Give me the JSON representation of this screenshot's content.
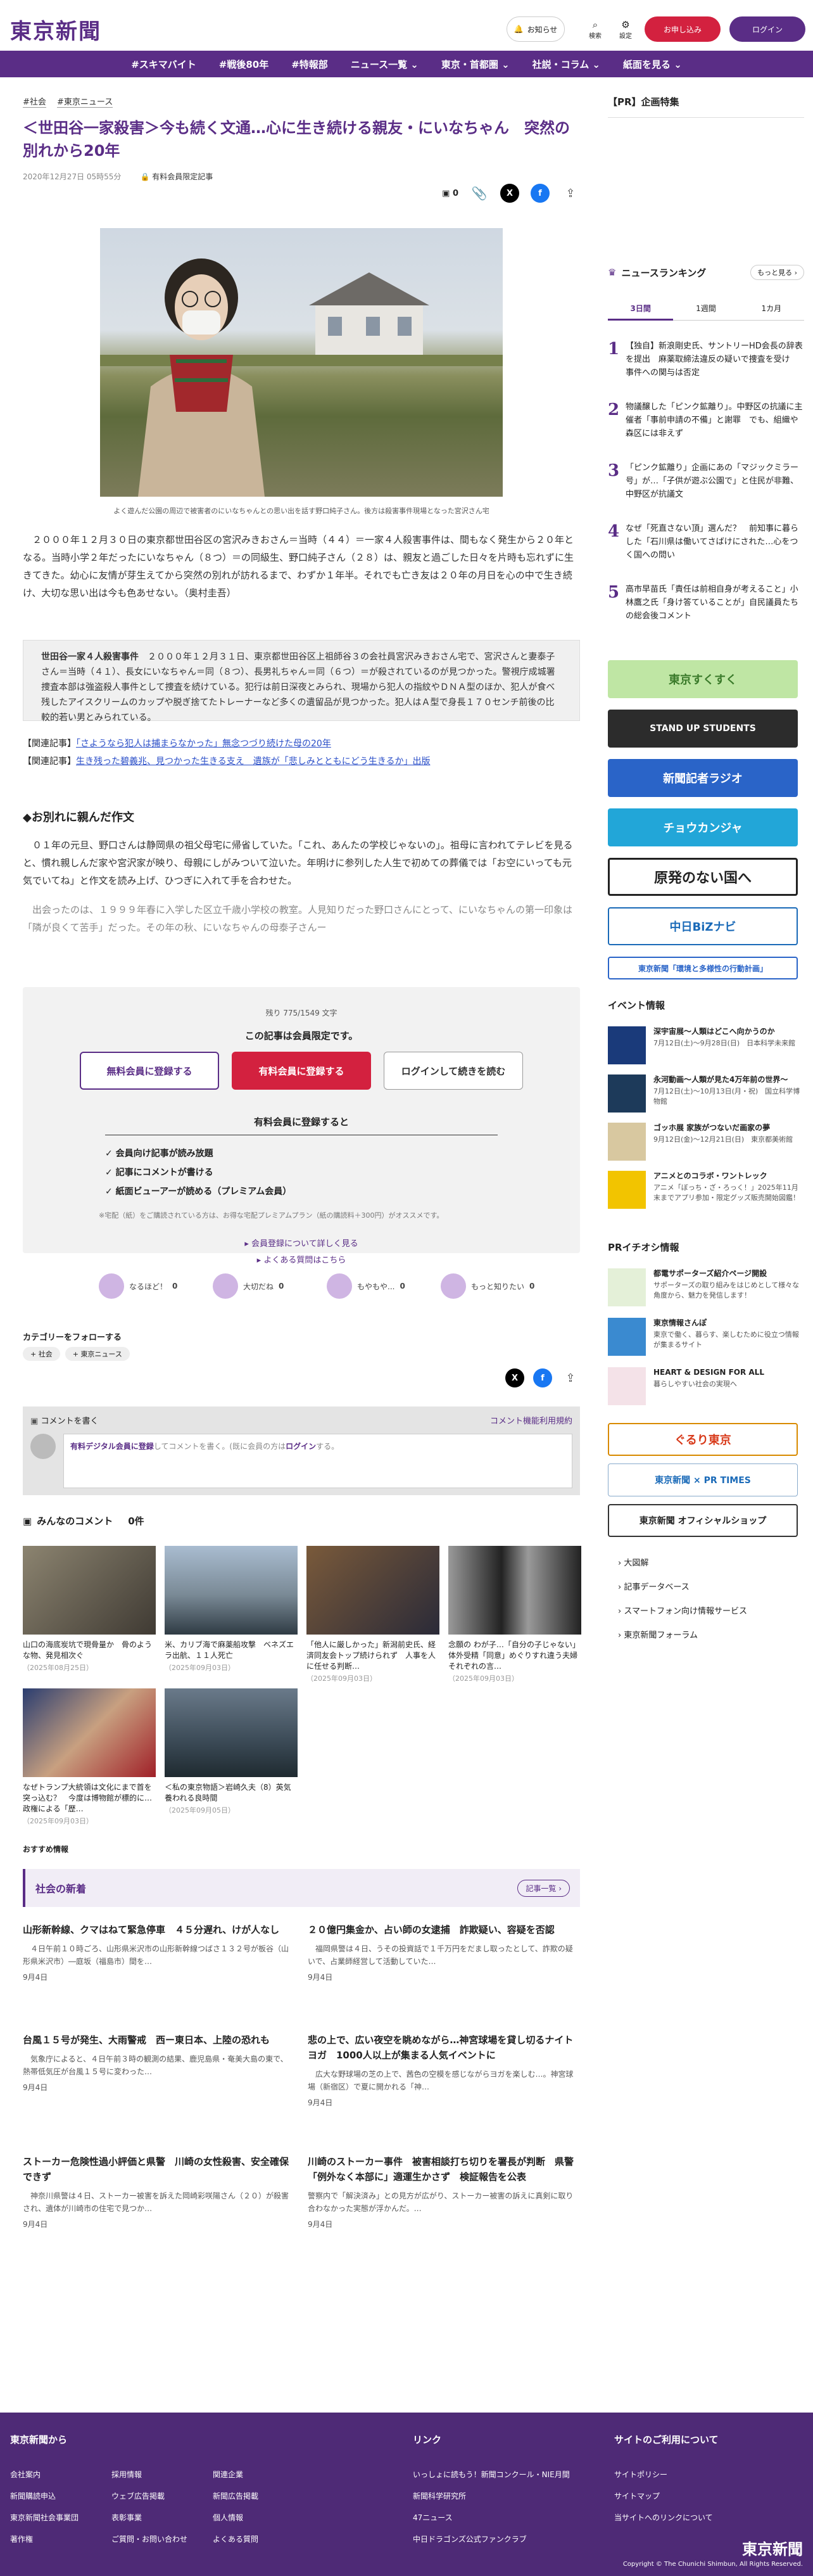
{
  "header": {
    "logo": "東京新聞",
    "notice": "お知らせ",
    "search": "検索",
    "settings": "設定",
    "subscribe": "お申し込み",
    "login": "ログイン"
  },
  "nav": [
    "#スキマバイト",
    "#戦後80年",
    "#特報部",
    "ニュース一覧 ⌄",
    "東京・首都圏 ⌄",
    "社説・コラム ⌄",
    "紙面を見る ⌄"
  ],
  "article": {
    "tags": [
      "#社会",
      "#東京ニュース"
    ],
    "title": "＜世田谷一家殺害＞今も続く文通…心に生き続ける親友・にいなちゃん　突然の別れから20年",
    "date": "2020年12月27日 05時55分",
    "member_label": "有料会員限定記事",
    "comment_count": "0",
    "caption": "よく遊んだ公園の周辺で被害者のにいなちゃんとの思い出を話す野口純子さん。後方は殺害事件現場となった宮沢さん宅",
    "lead": "　２０００年１２月３０日の東京都世田谷区の宮沢みきおさん＝当時（４４）＝一家４人殺害事件は、間もなく発生から２０年となる。当時小学２年だったにいなちゃん（８つ）＝の同級生、野口純子さん（２８）は、親友と過ごした日々を片時も忘れずに生きてきた。幼心に友情が芽生えてから突然の別れが訪れるまで、わずか１年半。それでも亡き友は２０年の月日を心の中で生き続け、大切な思い出は今も色あせない。（奥村圭吾）",
    "box_title": "世田谷一家４人殺害事件",
    "box_text": "　２０００年１２月３１日、東京都世田谷区上祖師谷３の会社員宮沢みきおさん宅で、宮沢さんと妻泰子さん＝当時（４１）、長女にいなちゃん＝同（８つ）、長男礼ちゃん＝同（６つ）＝が殺されているのが見つかった。警視庁成城署捜査本部は強盗殺人事件として捜査を続けている。犯行は前日深夜とみられ、現場から犯人の指紋やＤＮＡ型のほか、犯人が食べ残したアイスクリームのカップや脱ぎ捨てたトレーナーなど多くの遺留品が見つかった。犯人はＡ型で身長１７０センチ前後の比較的若い男とみられている。",
    "related_1_label": "【関連記事】",
    "related_1": "「さようなら犯人は捕まらなかった」無念つづり続けた母の20年",
    "related_2_label": "【関連記事】",
    "related_2": "生き残った碧義兆、見つかった生きる支え　遺族が「悲しみとともにどう生きるか」出版",
    "subhead": "◆お別れに親んだ作文",
    "para1": "　０１年の元旦、野口さんは静岡県の祖父母宅に帰省していた。「これ、あんたの学校じゃないの」。祖母に言われてテレビを見ると、慣れ親しんだ家や宮沢家が映り、母親にしがみついて泣いた。年明けに参列した人生で初めての葬儀では「お空にいっても元気でいてね」と作文を読み上げ、ひつぎに入れて手を合わせた。",
    "para2": "　出会ったのは、１９９９年春に入学した区立千歳小学校の教室。人見知りだった野口さんにとって、にいなちゃんの第一印象は「隣が良くて苦手」だった。その年の秋、にいなちゃんの母泰子さんー",
    "remaining": "残り 775/1549 文字",
    "paywall_title": "この記事は会員限定です。",
    "btn_free": "無料会員に登録する",
    "btn_paid": "有料会員に登録する",
    "btn_login": "ログインして続きを読む",
    "benefits_title": "有料会員に登録すると",
    "benefits": [
      "会員向け記事が読み放題",
      "記事にコメントが書ける",
      "紙面ビューアーが読める（プレミアム会員）"
    ],
    "note": "※宅配（紙）をご購読されている方は、お得な宅配プレミアムプラン（紙の購読料＋300円）がオススメです。",
    "more_1": "会員登録について詳しく見る",
    "more_2": "よくある質問はこちら",
    "reactions": [
      "なるほど！",
      "大切だね",
      "もやもや...",
      "もっと知りたい"
    ],
    "reaction_counts": [
      "0",
      "0",
      "0",
      "0"
    ],
    "follow": "カテゴリーをフォローする",
    "follow_tags": [
      "社会",
      "東京ニュース"
    ],
    "comment_write": "コメントを書く",
    "comment_terms": "コメント機能利用規約",
    "comment_placeholder_a": "有料デジタル会員に登録",
    "comment_placeholder_b": "してコメントを書く。(既に会員の方は",
    "comment_placeholder_c": "ログイン",
    "comment_placeholder_d": "する。",
    "all_comments": "みんなのコメント",
    "all_comments_count": "0件"
  },
  "cards": [
    {
      "title": "山口の海底炭坑で現骨量か　骨のような物、発見相次ぐ",
      "date": "（2025年08月25日）"
    },
    {
      "title": "米、カリブ海で麻薬船攻撃　ベネズエラ出航、１１人死亡",
      "date": "（2025年09月03日）"
    },
    {
      "title": "「他人に厳しかった」新潟前史氏、経済同友会トップ続けられず　人事を人に任せる判断…",
      "date": "（2025年09月03日）"
    },
    {
      "title": "念願の わが子…「自分の子じゃない」体外受精「同意」めぐりすれ違う夫婦　それぞれの言…",
      "date": "（2025年09月03日）"
    },
    {
      "title": "なぜトランプ大統領は文化にまで首を突っ込む？　今度は博物館が標的に…政権による「歴…",
      "date": "（2025年09月03日）"
    },
    {
      "title": "＜私の東京物語＞岩崎久夫（8）英気養われる良時間",
      "date": "（2025年09月05日）"
    }
  ],
  "recommend_label": "おすすめ情報",
  "society": {
    "title": "社会の新着",
    "more": "記事一覧",
    "items": [
      {
        "title": "山形新幹線、クマはねて緊急停車　４５分遅れ、けが人なし",
        "sum": "　４日午前１０時ごろ、山形県米沢市の山形新幹線つばさ１３２号が板谷（山形県米沢市）―庭坂（福島市）間を…",
        "date": "9月4日"
      },
      {
        "title": "２０億円集金か、占い師の女逮捕　詐欺疑い、容疑を否認",
        "sum": "　福岡県警は４日、うその投資話で１千万円をだまし取ったとして、詐欺の疑いで、占業師経営して活動していた…",
        "date": "9月4日"
      },
      {
        "title": "台風１５号が発生、大雨警戒　西ー東日本、上陸の恐れも",
        "sum": "　気象庁によると、４日午前３時の観測の結果、鹿児島県・奄美大島の東で、熱帯低気圧が台風１５号に変わった…",
        "date": "9月4日"
      },
      {
        "title": "悲の上で、広い夜空を眺めながら…神宮球場を貸し切るナイトヨガ　1000人以上が集まる人気イベントに",
        "sum": "　広大な野球場の芝の上で、茜色の空模を感じながらヨガを楽しむ…。神宮球場（新宿区）で夏に開かれる「神…",
        "date": "9月4日"
      },
      {
        "title": "ストーカー危険性過小評価と県警　川崎の女性殺害、安全確保できず",
        "sum": "　神奈川県警は４日、ストーカー被害を訴えた岡崎彩咲陽さん（２０）が殺害され、遺体が川崎市の住宅で見つか…",
        "date": "9月4日"
      },
      {
        "title": "川崎のストーカー事件　被害相談打ち切りを署長が判断　県警「例外なく本部に」適運生かさず　検証報告を公表",
        "sum": "警察内で「解決済み」との見方が広がり、ストーカー被害の訴えに真剣に取り合わなかった実態が浮かんだ。…",
        "date": "9月4日"
      }
    ]
  },
  "sidebar": {
    "pr_title": "【PR】企画特集",
    "ranking_title": "ニュースランキング",
    "ranking_more": "もっと見る",
    "ranking_tabs": [
      "3日間",
      "1週間",
      "1カ月"
    ],
    "ranking": [
      {
        "n": "1",
        "t": "【独自】新浪剛史氏、サントリーHD会長の辞表を提出　麻薬取締法違反の疑いで捜査を受け　事件への関与は否定"
      },
      {
        "n": "2",
        "t": "物議醸した「ピンク鉱離り」。中野区の抗議に主催者「事前申請の不備」と謝罪　でも、組織や森区には非えず"
      },
      {
        "n": "3",
        "t": "「ピンク鉱離り」企画にあの「マジックミラー号」が…「子供が遊ぶ公園で」と住民が非難、中野区が抗議文"
      },
      {
        "n": "4",
        "t": "なぜ「死直さない頂」選んだ？　前知事に暮らした「石川県は働いてさばけにされた…心をつく国への問い"
      },
      {
        "n": "5",
        "t": "高市早苗氏「責任は前相自身が考えること」小林鷹之氏「身け答ていることが」自民議員たちの総会後コメント"
      }
    ],
    "banners": [
      "東京すくすく",
      "STAND UP STUDENTS",
      "新聞記者ラジオ",
      "チョウカンジャ",
      "原発のない国へ",
      "中日BiZナビ",
      "東京新聞「環境と多様性の行動計画」"
    ],
    "events_title": "イベント情報",
    "events": [
      {
        "t": "深宇宙展〜人類はどこへ向かうのか",
        "s": "7月12日(土)〜9月28日(日)　日本科学未来館"
      },
      {
        "t": "永河動画〜人類が見た4万年前の世界〜",
        "s": "7月12日(土)〜10月13日(月・祝)　国立科学博物館"
      },
      {
        "t": "ゴッホ展 家族がつないだ画家の夢",
        "s": "9月12日(金)〜12月21日(日)　東京都美術館"
      },
      {
        "t": "アニメとのコラボ・ワントレック",
        "s": "アニメ「ぼっち・ざ・ろっく！」2025年11月末までアプリ参加・限定グッズ販売開始図鑑！"
      }
    ],
    "pr_info_title": "PRイチオシ情報",
    "pr_info": [
      {
        "t": "都電サポーターズ紹介ページ開設",
        "s": "サポーターズの取り組みをはじめとして様々な角度から、魅力を発信します！"
      },
      {
        "t": "東京情報さんぽ",
        "s": "東京で働く、暮らす、楽しむために役立つ情報が集まるサイト"
      },
      {
        "t": "HEART & DESIGN FOR ALL",
        "s": "暮らしやすい社会の実現へ"
      }
    ],
    "banners2": [
      "ぐるり東京",
      "東京新聞 × PR TIMES",
      "東京新聞 オフィシャルショップ"
    ],
    "links": [
      "大図解",
      "記事データベース",
      "スマートフォン向け情報サービス",
      "東京新聞フォーラム"
    ]
  },
  "footer": {
    "col1_title": "東京新聞から",
    "col1": [
      "会社案内",
      "新聞購読申込",
      "東京新聞社会事業団",
      "著作権",
      "採用情報",
      "ウェブ広告掲載",
      "表彰事業",
      "ご質問・お問い合わせ",
      "関連企業",
      "新聞広告掲載",
      "個人情報",
      "よくある質問"
    ],
    "col2_title": "リンク",
    "col2": [
      "いっしょに読もう！新聞コンクール・NIE月間",
      "新聞科学研究所",
      "47ニュース",
      "中日ドラゴンズ公式ファンクラブ"
    ],
    "col3_title": "サイトのご利用について",
    "col3": [
      "サイトポリシー",
      "サイトマップ",
      "当サイトへのリンクについて"
    ],
    "logo": "東京新聞",
    "copyright": "Copyright © The Chunichi Shimbun, All Rights Reserved."
  },
  "colors": {
    "brand": "#5a2d86",
    "accent": "#d3213f"
  }
}
